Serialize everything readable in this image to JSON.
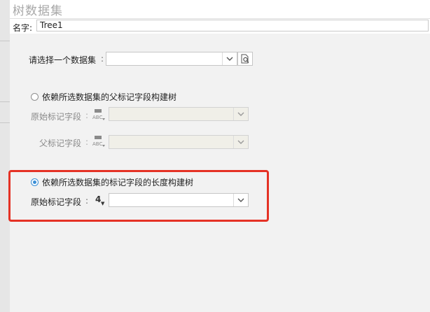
{
  "window": {
    "title": "树数据集"
  },
  "name_field": {
    "label": "名字",
    "colon": ":",
    "value": "Tree1"
  },
  "dataset_select": {
    "label": "请选择一个数据集",
    "colon": ":",
    "value": ""
  },
  "option_parent": {
    "label": "依赖所选数据集的父标记字段构建树",
    "selected": false,
    "fields": [
      {
        "label": "原始标记字段",
        "colon": ":",
        "type_icon": "abc-field-type-icon",
        "value": ""
      },
      {
        "label": "父标记字段",
        "colon": ":",
        "type_icon": "abc-field-type-icon",
        "value": ""
      }
    ]
  },
  "option_length": {
    "label": "依赖所选数据集的标记字段的长度构建树",
    "selected": true,
    "field": {
      "label": "原始标记字段",
      "colon": ":",
      "type_glyph": "4",
      "value": ""
    }
  },
  "colors": {
    "highlight": "#e53225",
    "radio_accent": "#3b8fd6"
  }
}
